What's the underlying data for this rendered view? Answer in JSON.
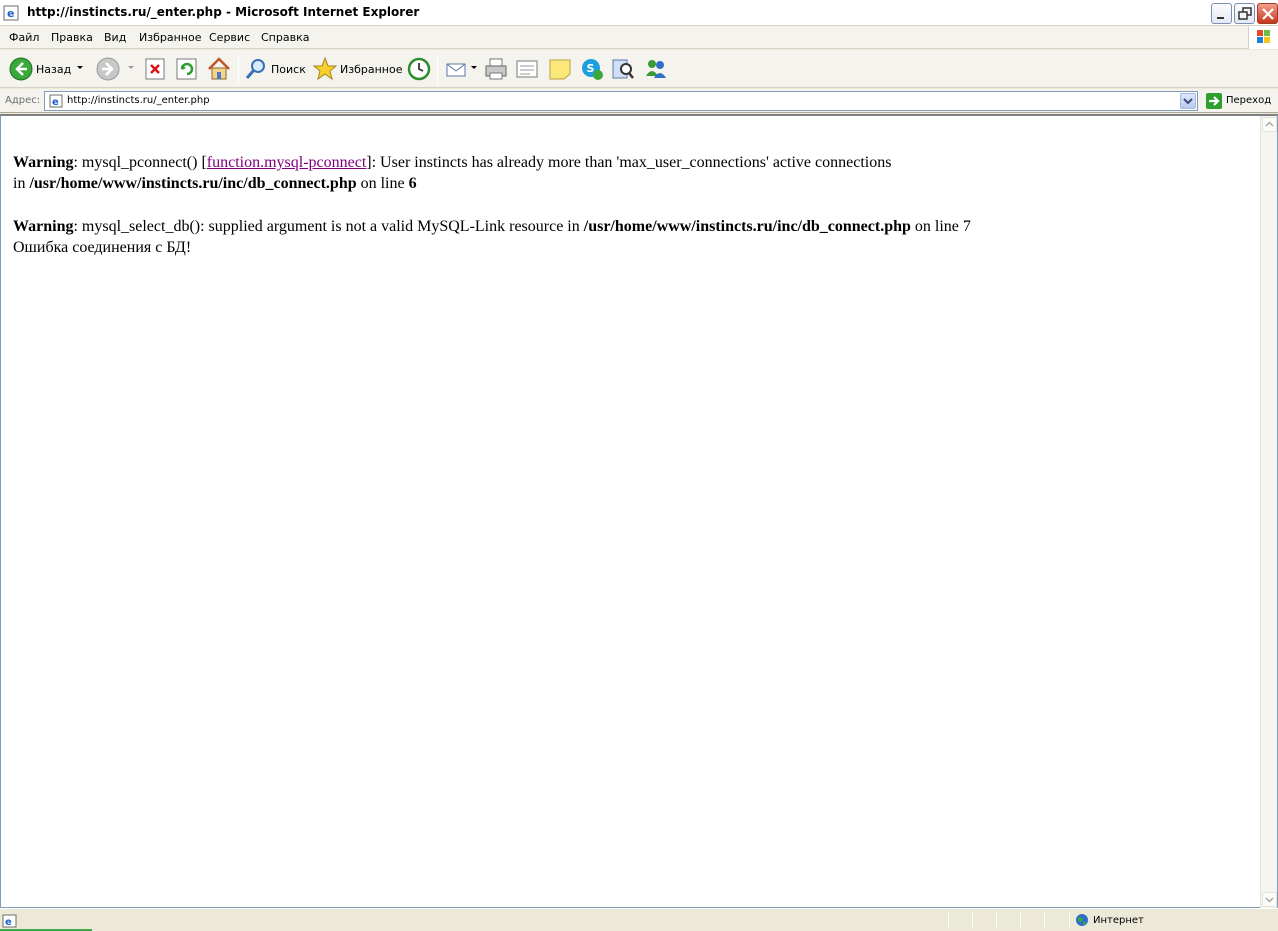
{
  "window": {
    "title": "http://instincts.ru/_enter.php - Microsoft Internet Explorer"
  },
  "menu": {
    "items": [
      "Файл",
      "Правка",
      "Вид",
      "Избранное",
      "Сервис",
      "Справка"
    ]
  },
  "toolbar": {
    "back_label": "Назад",
    "search_label": "Поиск",
    "favorites_label": "Избранное"
  },
  "address": {
    "label": "Адрес:",
    "url": "http://instincts.ru/_enter.php",
    "go_label": "Переход"
  },
  "page": {
    "warning1": {
      "label": "Warning",
      "text_before_link": ": mysql_pconnect() [",
      "link_text": "function.mysql-pconnect",
      "text_after_link": "]: User instincts has already more than 'max_user_connections' active connections",
      "in_word": "in",
      "file": "/usr/home/www/instincts.ru/inc/db_connect.php",
      "on_line": "on line",
      "line": "6"
    },
    "warning2": {
      "label": "Warning",
      "text": ": mysql_select_db(): supplied argument is not a valid MySQL-Link resource in",
      "file": "/usr/home/www/instincts.ru/inc/db_connect.php",
      "on_line": "on line 7"
    },
    "error_message": "Ошибка соединения с БД!"
  },
  "status": {
    "zone": "Интернет"
  },
  "colors": {
    "visited_link": "#800080",
    "chrome_bg": "#ece9d8"
  }
}
